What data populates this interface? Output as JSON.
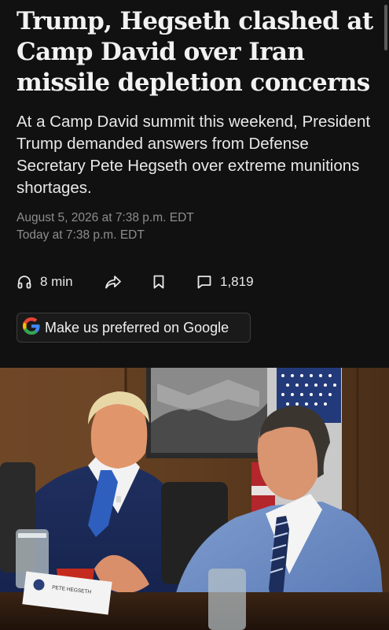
{
  "article": {
    "headline": "Trump, Hegseth clashed at Camp David over Iran missile depletion concerns",
    "dek": "At a Camp David summit this weekend, President Trump demanded answers from Defense Secretary Pete Hegseth over extreme munitions shortages.",
    "published": "August 5, 2026 at 7:38 p.m. EDT",
    "updated": "Today at 7:38 p.m. EDT"
  },
  "actions": {
    "listen": {
      "icon": "headphones-icon",
      "label": "8 min"
    },
    "share": {
      "icon": "share-arrow-icon"
    },
    "save": {
      "icon": "bookmark-icon"
    },
    "comments": {
      "icon": "comment-icon",
      "label": "1,819"
    }
  },
  "google_preferred": {
    "icon": "google-g-icon",
    "label": "Make us preferred on Google"
  },
  "photo": {
    "nameplate_text": "PETE HEGSETH"
  },
  "colors": {
    "background": "#111111",
    "headline": "#f2f2f2",
    "meta": "#8d8d8d",
    "google_blue": "#4285F4",
    "google_red": "#EA4335",
    "google_yellow": "#FBBC05",
    "google_green": "#34A853"
  }
}
